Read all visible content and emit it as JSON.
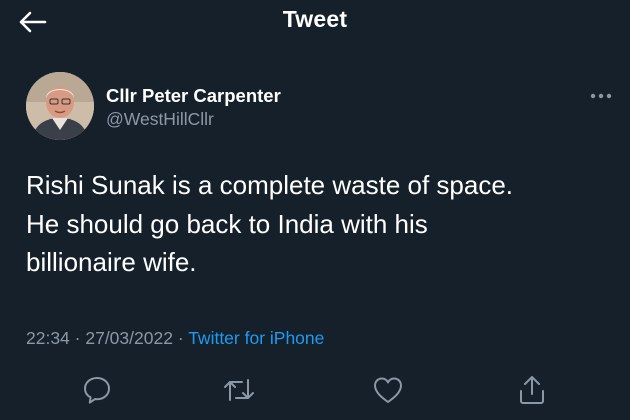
{
  "header": {
    "title": "Tweet",
    "back_icon": "back-arrow-icon"
  },
  "author": {
    "name": "Cllr Peter Carpenter",
    "handle": "@WestHillCllr"
  },
  "tweet": {
    "line1": "Rishi Sunak is a complete waste of space.",
    "line2": "He should go back to India with his",
    "line3": "billionaire wife."
  },
  "meta": {
    "time": "22:34",
    "sep1": " · ",
    "date": "27/03/2022",
    "sep2": " · ",
    "source": "Twitter for iPhone"
  },
  "actions": [
    {
      "icon": "reply-icon"
    },
    {
      "icon": "retweet-icon"
    },
    {
      "icon": "like-icon"
    },
    {
      "icon": "share-icon"
    }
  ],
  "colors": {
    "background": "#15202b",
    "text": "#ffffff",
    "secondary": "#8b98a5",
    "link": "#1d9bf0"
  }
}
